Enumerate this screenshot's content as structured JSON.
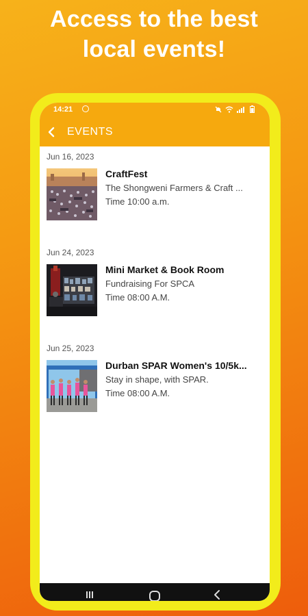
{
  "headline": {
    "line1": "Access to the best",
    "line2": "local events!"
  },
  "status_bar": {
    "time": "14:21",
    "icons": [
      "notification-circle-icon",
      "mute-icon",
      "wifi-icon",
      "signal-icon",
      "battery-icon"
    ]
  },
  "app_bar": {
    "title": "EVENTS",
    "back_icon": "chevron-left-icon"
  },
  "events": [
    {
      "date": "Jun 16, 2023",
      "title": "CraftFest",
      "subtitle": "The Shongweni Farmers & Craft ...",
      "time": "Time 10:00 a.m.",
      "image": "market-crowd-photo"
    },
    {
      "date": "Jun 24, 2023",
      "title": "Mini Market & Book Room",
      "subtitle": "Fundraising For SPCA",
      "time": "Time 08:00 A.M.",
      "image": "book-room-photo"
    },
    {
      "date": "Jun 25, 2023",
      "title": "Durban SPAR Women's 10/5k...",
      "subtitle": "Stay in shape, with SPAR.",
      "time": "Time 08:00 A.M.",
      "image": "runners-photo"
    }
  ],
  "colors": {
    "app_bar": "#f6a90e",
    "phone_frame": "#f2ec1b",
    "background_top": "#f7b21a",
    "background_bottom": "#ee5d0c"
  }
}
